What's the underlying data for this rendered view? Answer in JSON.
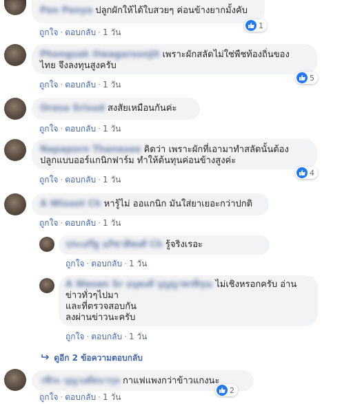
{
  "actions": {
    "like": "ถูกใจ",
    "reply": "ตอบกลับ",
    "dot": "·"
  },
  "comments": [
    {
      "name": "Pan Panya",
      "text": "ปลูกผักให้ได้ใบสวยๆ ค่อนข้างยากมั้งคับ",
      "time": "1 วัน",
      "likes": "1"
    },
    {
      "name": "Phongsak Owagarsonjit",
      "text": "เพราะผักสลัดไม่ใช่พืชท้องถิ่นของ",
      "text2": "ไทย จึงลงทุนสูงครับ",
      "time": "1 วัน",
      "likes": "5"
    },
    {
      "name": "Orasa Srisud",
      "text": "สงสัยเหมือนกันค่ะ",
      "time": "1 วัน"
    },
    {
      "name": "Napaporn Thanasee",
      "text": "คิดว่า เพราะผักที่เอามาทำสลัดนั้นต้อง",
      "text2": "ปลูกแบบออร์แกนิกฟาร์ม ทำให้ต้นทุนค่อนข้างสูงค่ะ",
      "time": "1 วัน",
      "likes": "4"
    },
    {
      "name": "A Wisoot Ch",
      "text": "หารู้ไม่ ออแกนิก มันใส่ยาเยอะกว่าปกติ",
      "time": "1 วัน"
    }
  ],
  "replies": [
    {
      "name": "ประเสริฐ อภิชาติพงศ์ Ch",
      "text": "รู้จริงเรอะ",
      "time": "1 วัน"
    },
    {
      "name": "A Wasan Sr อนุพงศ์ บุญญาพรพิรุณ",
      "text": "ไม่เชิงหรอกครับ อ่าน",
      "text2": "ข่าวทั่วๆไปมา",
      "text3": "และที่ตรวจสอบกัน",
      "text4": "ลงผ่านข่าวนะครับ",
      "time": "1 วัน"
    }
  ],
  "more_replies": "ดูอีก 2 ข้อความตอบกลับ",
  "last_comment": {
    "name": "วชิระ บุญวงศ์ธนากุล",
    "text": "กาแฟแพงกว่าข้าวแกงนะ",
    "time": "1 วัน",
    "likes": "2"
  }
}
